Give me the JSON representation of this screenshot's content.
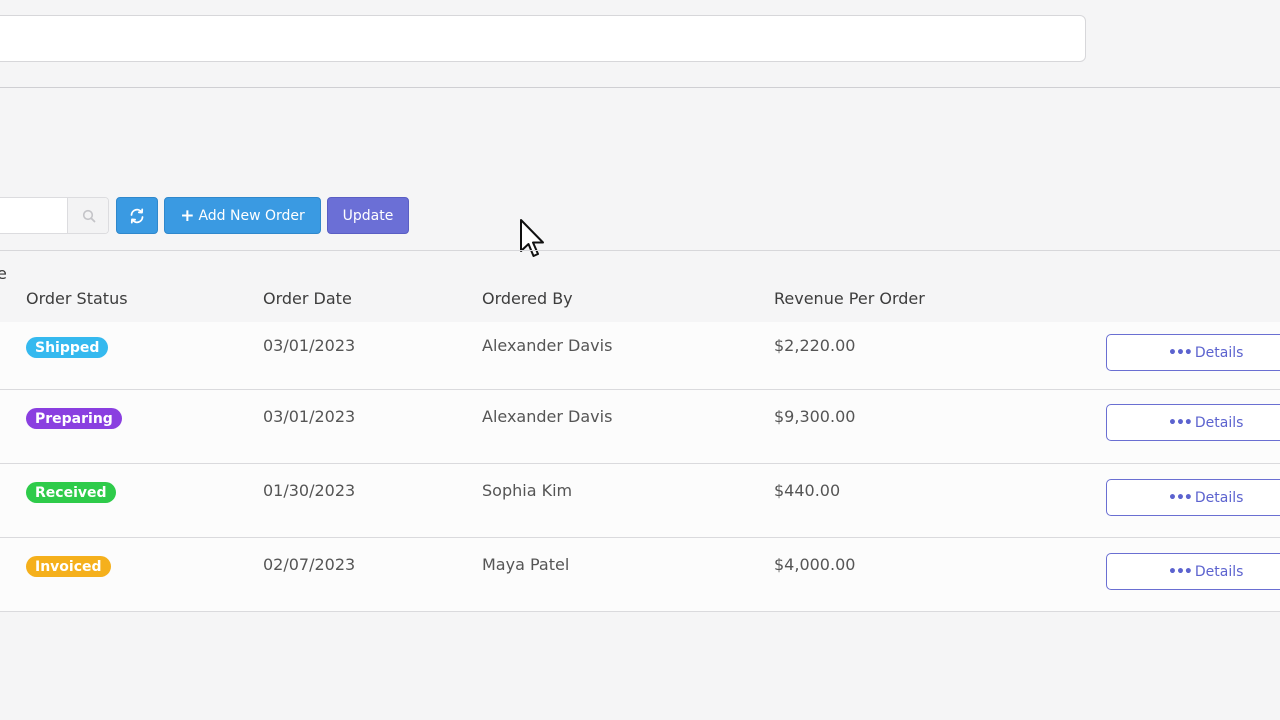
{
  "toolbar": {
    "add_label": "Add New Order",
    "update_label": "Update"
  },
  "table": {
    "partial_header_char": "e",
    "headers": [
      "Order Status",
      "Order Date",
      "Ordered By",
      "Revenue Per Order"
    ],
    "rows": [
      {
        "status": "Shipped",
        "status_color": "#35b9ef",
        "date": "03/01/2023",
        "by": "Alexander Davis",
        "revenue": "$2,220.00",
        "action": "Details"
      },
      {
        "status": "Preparing",
        "status_color": "#8a3fe0",
        "date": "03/01/2023",
        "by": "Alexander Davis",
        "revenue": "$9,300.00",
        "action": "Details"
      },
      {
        "status": "Received",
        "status_color": "#2ecb4a",
        "date": "01/30/2023",
        "by": "Sophia Kim",
        "revenue": "$440.00",
        "action": "Details"
      },
      {
        "status": "Invoiced",
        "status_color": "#f5b01c",
        "date": "02/07/2023",
        "by": "Maya Patel",
        "revenue": "$4,000.00",
        "action": "Details"
      }
    ]
  },
  "colors": {
    "primary_button": "#3a9ae2",
    "update_button": "#6b6fd6",
    "details_border": "#6a6fd2"
  },
  "icons": {
    "search": "search-icon",
    "refresh": "refresh-icon",
    "add": "plus-icon",
    "details": "more-dots-icon",
    "cursor": "mouse-pointer-icon"
  }
}
